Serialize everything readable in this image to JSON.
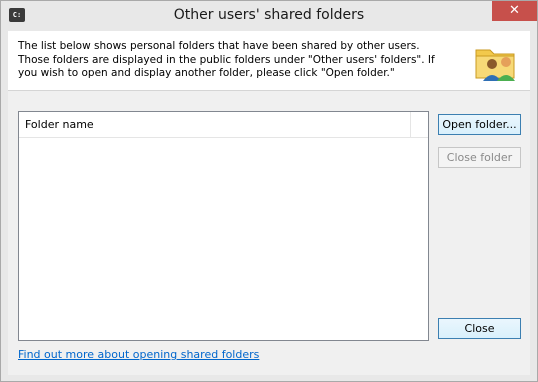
{
  "window": {
    "title": "Other users' shared folders",
    "app_icon_text": "C:",
    "close_glyph": "✕"
  },
  "info": {
    "text": "The list below shows personal folders that have been shared by other users. Those folders are displayed in the public folders under \"Other users' folders\". If you wish to open and display another folder, please click \"Open folder.\"",
    "icon": "folder-with-users-icon"
  },
  "list": {
    "columns": [
      "Folder name",
      ""
    ],
    "rows": []
  },
  "buttons": {
    "open_folder": "Open folder...",
    "close_folder": "Close folder",
    "close": "Close"
  },
  "help_link": "Find out more about opening shared folders",
  "colors": {
    "close_button": "#c7504b",
    "link": "#0066cc",
    "accent_border": "#3c7fb1"
  }
}
